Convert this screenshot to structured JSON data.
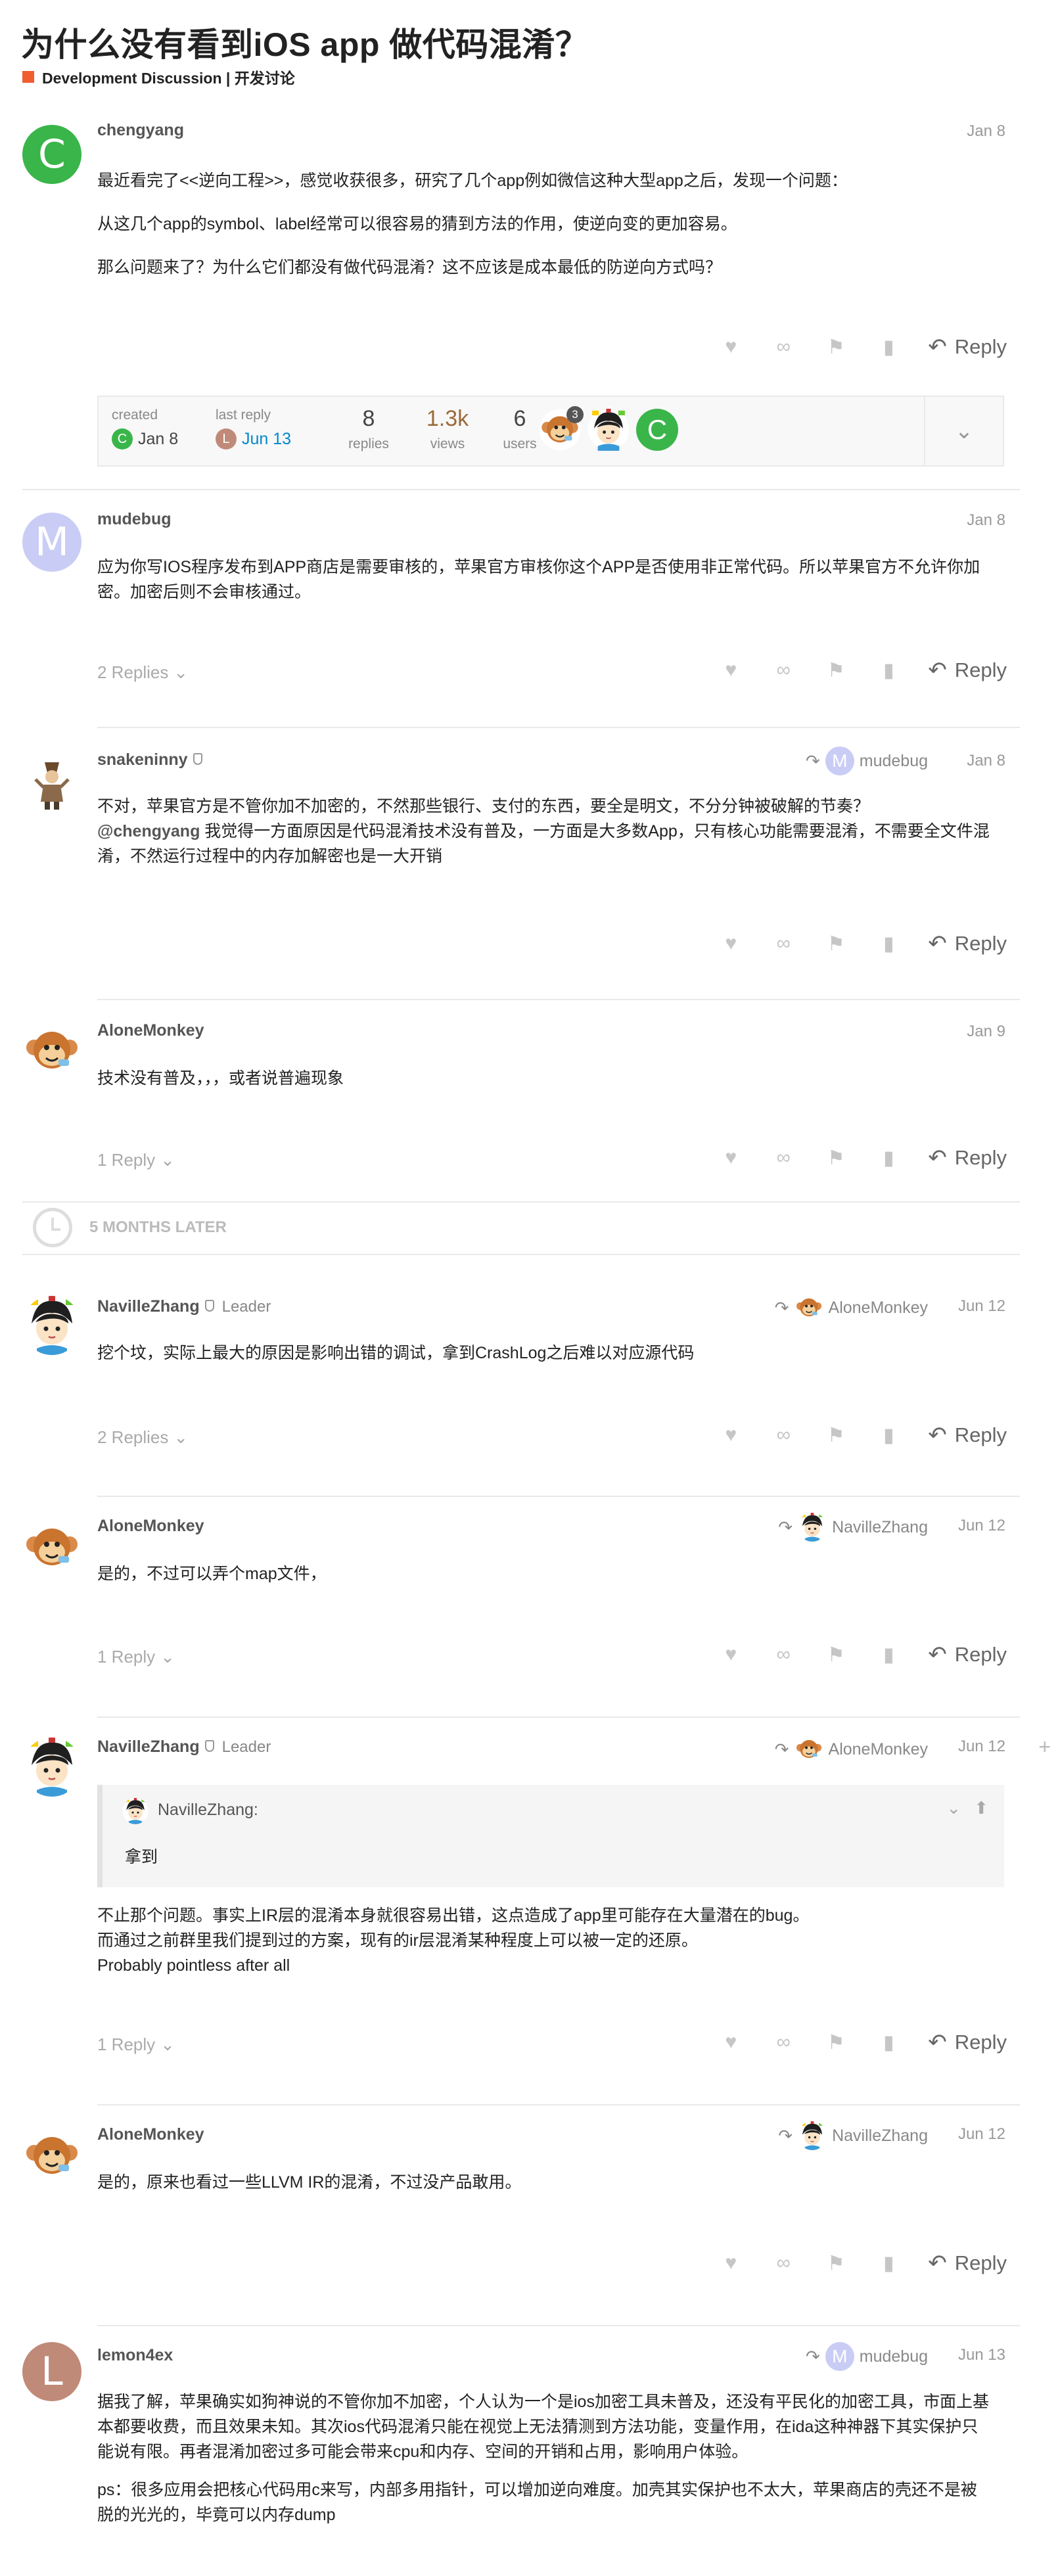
{
  "topic": {
    "title": "为什么没有看到iOS app 做代码混淆？",
    "category": "Development Discussion | 开发讨论",
    "category_color": "#f05d2e"
  },
  "colors": {
    "avatar_chengyang": "#3ab54a",
    "avatar_mudebug": "#c9cdf5",
    "avatar_lemon4ex": "#c08a78",
    "accent_link": "#0088cc",
    "views_color": "#9b6b3a"
  },
  "post_actions": {
    "reply_label": "Reply",
    "icons": [
      "heart-icon",
      "link-icon",
      "flag-icon",
      "bookmark-icon",
      "reply-arrow-icon"
    ]
  },
  "topic_map": {
    "created_label": "created",
    "created_date": "Jan 8",
    "last_reply_label": "last reply",
    "last_reply_date": "Jun 13",
    "replies_num": "8",
    "replies_label": "replies",
    "views_num": "1.3k",
    "views_label": "views",
    "users_num": "6",
    "users_label": "users",
    "participant_badge_count": "3"
  },
  "time_gap": {
    "label": "5 MONTHS LATER"
  },
  "posts": [
    {
      "username": "chengyang",
      "avatar_letter": "C",
      "date": "Jan 8",
      "paragraphs": [
        "最近看完了<<逆向工程>>，感觉收获很多，研究了几个app例如微信这种大型app之后，发现一个问题：",
        "从这几个app的symbol、label经常可以很容易的猜到方法的作用，使逆向变的更加容易。",
        "那么问题来了？为什么它们都没有做代码混淆？这不应该是成本最低的防逆向方式吗？"
      ]
    },
    {
      "username": "mudebug",
      "avatar_letter": "M",
      "date": "Jan 8",
      "paragraphs": [
        "应为你写IOS程序发布到APP商店是需要审核的，苹果官方审核你这个APP是否使用非正常代码。所以苹果官方不允许你加密。加密后则不会审核通过。"
      ],
      "replies": "2 Replies"
    },
    {
      "username": "snakeninny",
      "date": "Jan 8",
      "reply_to": "mudebug",
      "reply_to_letter": "M",
      "line1": "不对，苹果官方是不管你加不加密的，不然那些银行、支付的东西，要全是明文，不分分钟被破解的节奏？",
      "mention": "@chengyang",
      "line2": " 我觉得一方面原因是代码混淆技术没有普及，一方面是大多数App，只有核心功能需要混淆，不需要全文件混淆，不然运行过程中的内存加解密也是一大开销"
    },
    {
      "username": "AloneMonkey",
      "date": "Jan 9",
      "paragraphs": [
        "技术没有普及，，，或者说普遍现象"
      ],
      "replies": "1 Reply"
    },
    {
      "username": "NavilleZhang",
      "title_badge": "Leader",
      "date": "Jun 12",
      "reply_to": "AloneMonkey",
      "paragraphs": [
        "挖个坟，实际上最大的原因是影响出错的调试，拿到CrashLog之后难以对应源代码"
      ],
      "replies": "2 Replies"
    },
    {
      "username": "AloneMonkey",
      "date": "Jun 12",
      "reply_to": "NavilleZhang",
      "paragraphs": [
        "是的，不过可以弄个map文件，"
      ],
      "replies": "1 Reply"
    },
    {
      "username": "NavilleZhang",
      "title_badge": "Leader",
      "date": "Jun 12",
      "reply_to": "AloneMonkey",
      "quote_author": "NavilleZhang:",
      "quote_text": "拿到",
      "lines": [
        "不止那个问题。事实上IR层的混淆本身就很容易出错，这点造成了app里可能存在大量潜在的bug。",
        "而通过之前群里我们提到过的方案，现有的ir层混淆某种程度上可以被一定的还原。",
        "Probably pointless after all"
      ],
      "replies": "1 Reply"
    },
    {
      "username": "AloneMonkey",
      "date": "Jun 12",
      "reply_to": "NavilleZhang",
      "paragraphs": [
        "是的，原来也看过一些LLVM IR的混淆，不过没产品敢用。"
      ]
    },
    {
      "username": "lemon4ex",
      "avatar_letter": "L",
      "date": "Jun 13",
      "reply_to": "mudebug",
      "reply_to_letter": "M",
      "paragraphs": [
        "据我了解，苹果确实如狗神说的不管你加不加密，个人认为一个是ios加密工具未普及，还没有平民化的加密工具，市面上基本都要收费，而且效果未知。其次ios代码混淆只能在视觉上无法猜测到方法功能，变量作用，在ida这种神器下其实保护只能说有限。再者混淆加密过多可能会带来cpu和内存、空间的开销和占用，影响用户体验。",
        "ps：很多应用会把核心代码用c来写，内部多用指针，可以增加逆向难度。加壳其实保护也不太大，苹果商店的壳还不是被脱的光光的，毕竟可以内存dump"
      ]
    }
  ]
}
